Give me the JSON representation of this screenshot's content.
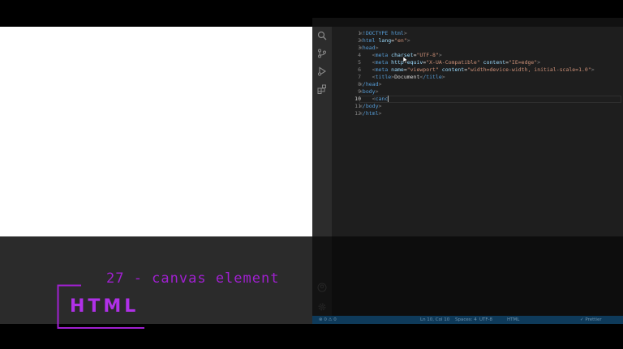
{
  "browser": {
    "content": ""
  },
  "topbar": {
    "text": ""
  },
  "activity_bar": {
    "icons": [
      "search-icon",
      "source-control-icon",
      "run-debug-icon",
      "extensions-icon",
      "account-icon",
      "settings-gear-icon"
    ]
  },
  "editor": {
    "active_line": 10,
    "lines": [
      {
        "n": "1",
        "text": "<!DOCTYPE html>"
      },
      {
        "n": "2",
        "text": "<html lang=\"en\">"
      },
      {
        "n": "3",
        "text": "<head>"
      },
      {
        "n": "4",
        "text": "    <meta charset=\"UTF-8\">"
      },
      {
        "n": "5",
        "text": "    <meta http-equiv=\"X-UA-Compatible\" content=\"IE=edge\">"
      },
      {
        "n": "6",
        "text": "    <meta name=\"viewport\" content=\"width=device-width, initial-scale=1.0\">"
      },
      {
        "n": "7",
        "text": "    <title>Document</title>"
      },
      {
        "n": "8",
        "text": "</head>"
      },
      {
        "n": "9",
        "text": "<body>"
      },
      {
        "n": "10",
        "text": "    <canc"
      },
      {
        "n": "11",
        "text": "</body>"
      },
      {
        "n": "12",
        "text": "</html>"
      }
    ]
  },
  "statusbar": {
    "left": "⊗ 0 ⚠ 0",
    "position": "Ln 10, Col 10",
    "spaces": "Spaces: 4",
    "encoding": "UTF-8",
    "language": "HTML",
    "prettier": "✓ Prettier"
  },
  "overlay": {
    "subtitle": "27 - canvas element",
    "logo": "HTML"
  },
  "colors": {
    "accent": "#a020d0",
    "editor_bg": "#1e1e1e",
    "status_bg": "#0e3a5a"
  }
}
